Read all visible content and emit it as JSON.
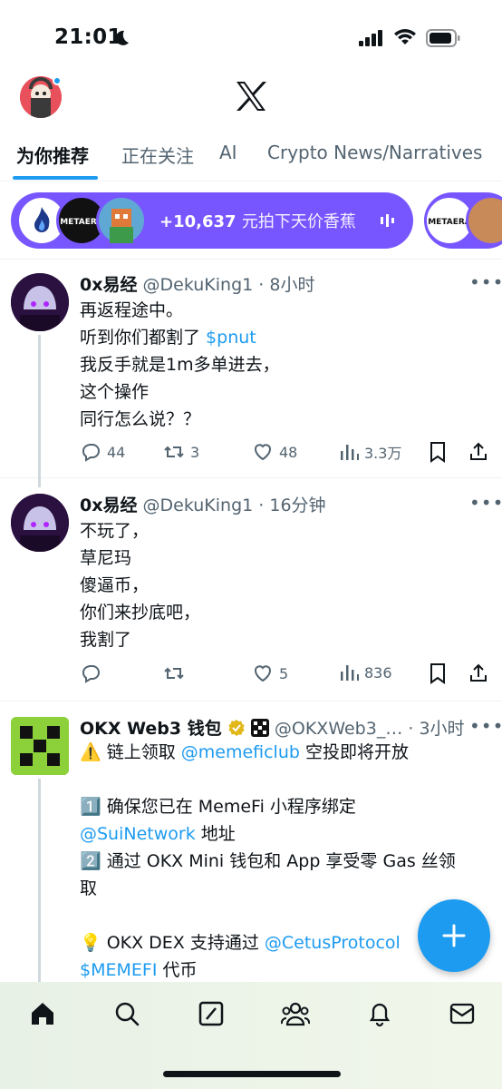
{
  "status_bar": {
    "time": "21:01"
  },
  "header": {
    "logo": "x-logo-icon"
  },
  "tabs": [
    {
      "label": "为你推荐",
      "active": true
    },
    {
      "label": "正在关注",
      "active": false
    },
    {
      "label": "AI",
      "active": false
    },
    {
      "label": "Crypto News/Narratives",
      "active": false
    }
  ],
  "spaces": {
    "listener_count": "+10,637",
    "title": "元拍下天价香蕉",
    "accent": "#7856ff"
  },
  "tweets": [
    {
      "name": "0x易经",
      "meta": "@DekuKing1 · 8小时",
      "lines": [
        "再返程途中。",
        "听到你们都割了 ",
        "我反手就是1m多单进去，",
        "这个操作",
        "同行怎么说？？"
      ],
      "cashtag": "$pnut",
      "replies": "44",
      "reposts": "3",
      "likes": "48",
      "views": "3.3万"
    },
    {
      "name": "0x易经",
      "meta": "@DekuKing1 · 16分钟",
      "lines": [
        "不玩了，",
        "草尼玛",
        "傻逼币，",
        "你们来抄底吧，",
        "我割了"
      ],
      "replies": "",
      "reposts": "",
      "likes": "5",
      "views": "836"
    },
    {
      "name": "OKX Web3 钱包",
      "meta": "@OKXWeb3_… · 3小时",
      "line1_pre": "⚠️ 链上领取 ",
      "line1_link": "@memeficlub",
      "line1_post": " 空投即将开放",
      "line2": "1️⃣ 确保您已在 MemeFi 小程序绑定",
      "line3_link": "@SuiNetwork",
      "line3_post": " 地址",
      "line4": "2️⃣ 通过 OKX Mini 钱包和 App 享受零 Gas 丝领",
      "line5": "取",
      "line6_pre": "💡 OKX DEX 支持通过 ",
      "line6_link": "@CetusProtocol",
      "line7_link": "$MEMEFI",
      "line7_post": " 代币"
    }
  ],
  "colors": {
    "link": "#1d9bf0",
    "text": "#0f1419",
    "muted": "#536471"
  }
}
